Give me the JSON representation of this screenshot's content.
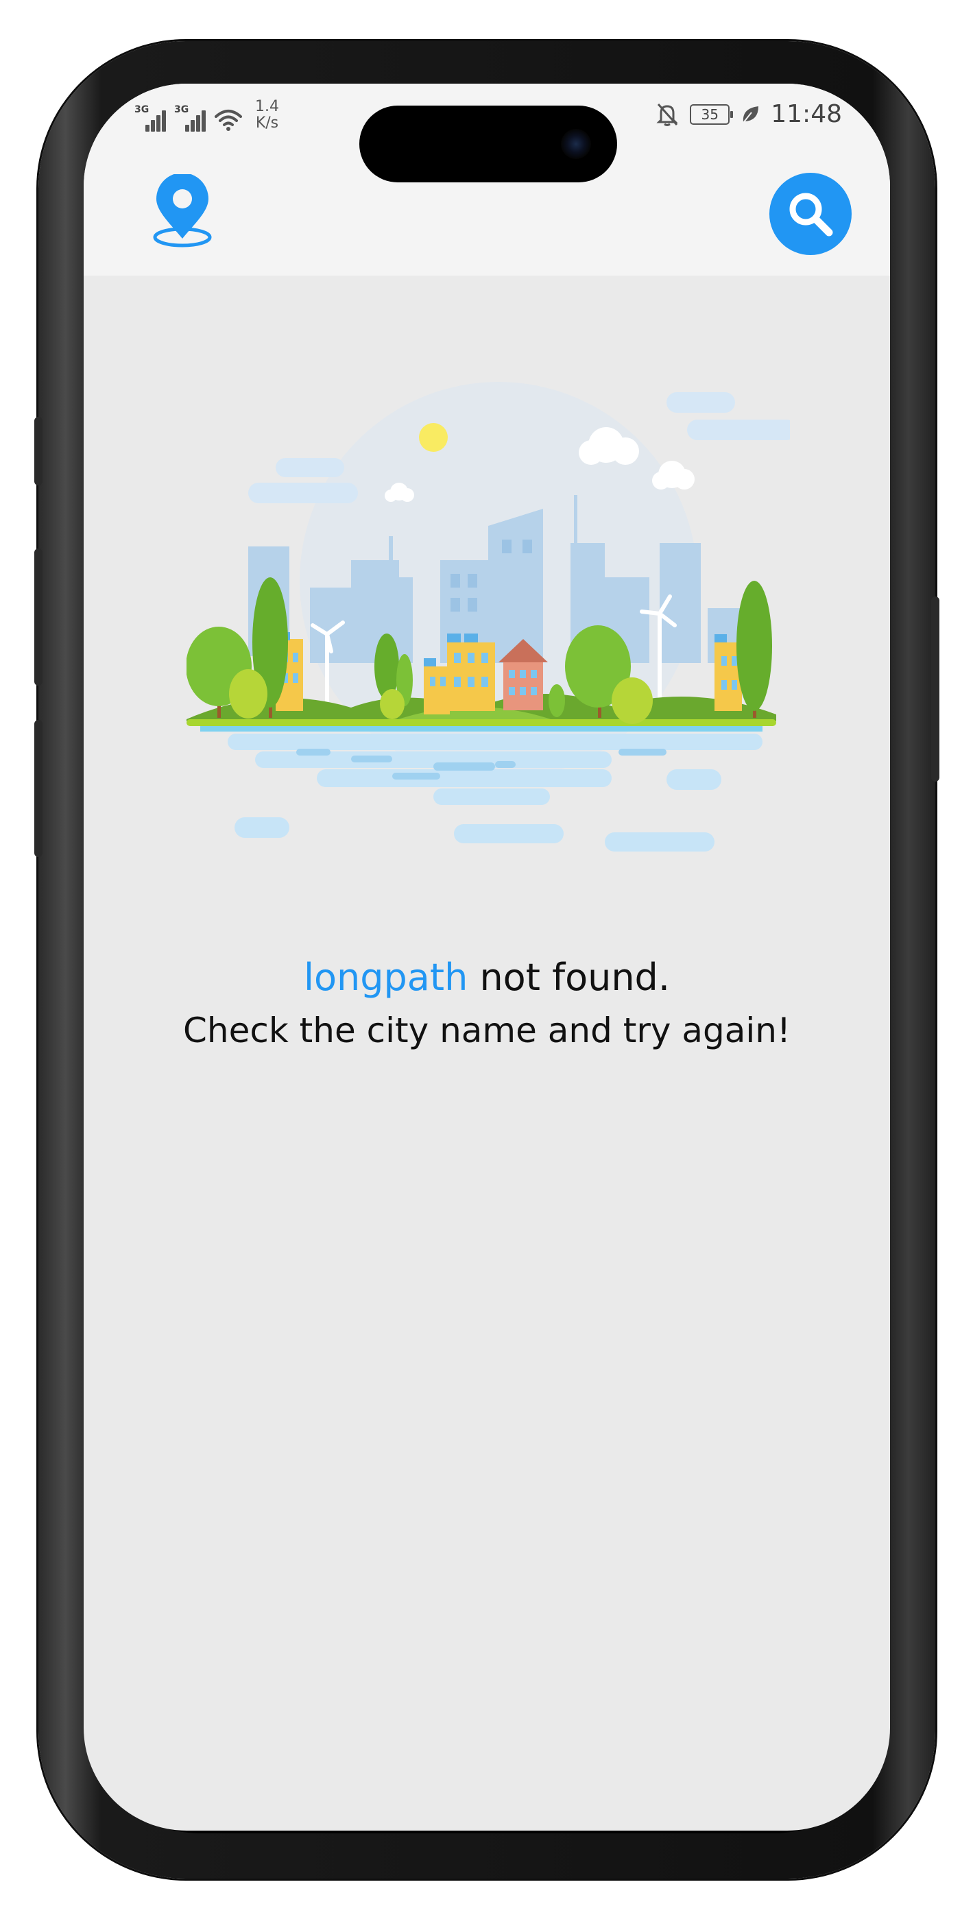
{
  "status_bar": {
    "network_1": "3G",
    "network_2": "3G",
    "speed_value": "1.4",
    "speed_unit": "K/s",
    "battery": "35",
    "time": "11:48"
  },
  "app_bar": {
    "location_icon": "location-pin-icon",
    "search_icon": "search-icon",
    "accent_color": "#2196f3"
  },
  "error": {
    "city": "longpath",
    "not_found": " not found.",
    "hint": "Check the city name and try again!"
  }
}
